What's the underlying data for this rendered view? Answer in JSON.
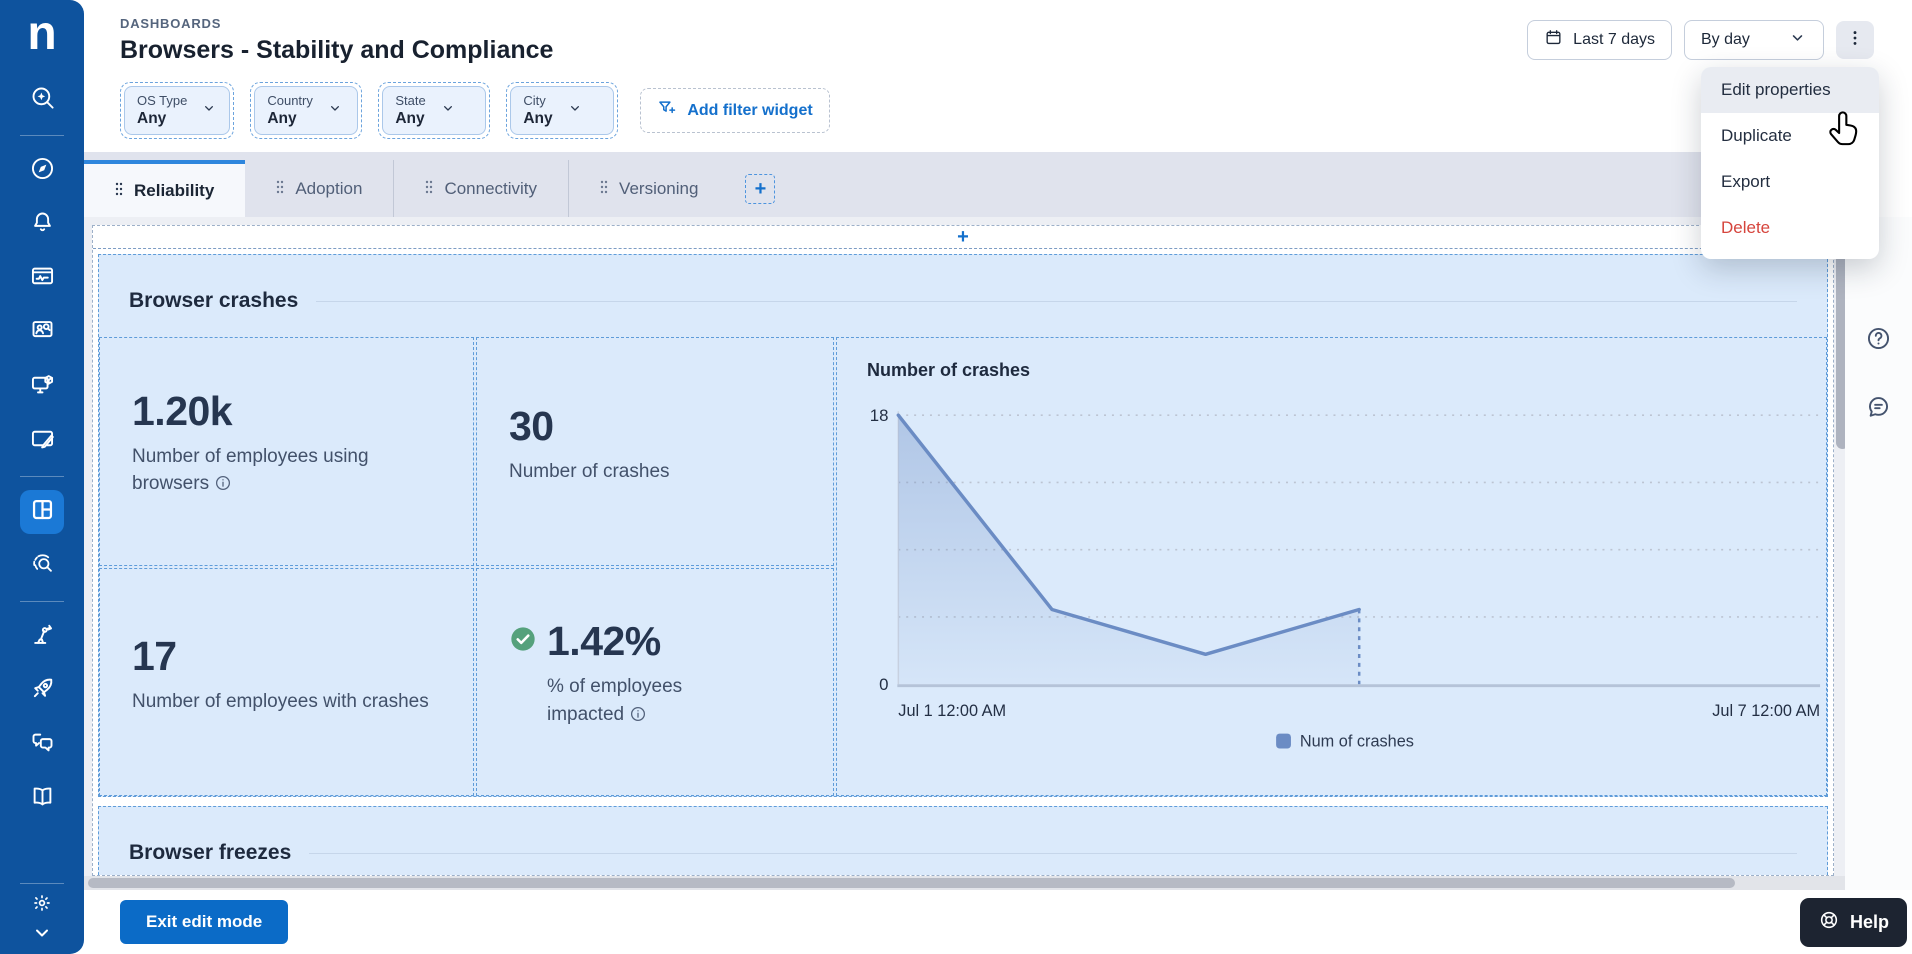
{
  "brand": {
    "logo_letter": "n"
  },
  "header": {
    "breadcrumb": "DASHBOARDS",
    "title": "Browsers - Stability and Compliance",
    "time_range_label": "Last 7 days",
    "granularity_label": "By day"
  },
  "menu": {
    "items": [
      {
        "label": "Edit properties",
        "state": "hovered"
      },
      {
        "label": "Duplicate"
      },
      {
        "label": "Export"
      },
      {
        "label": "Delete",
        "danger": true
      }
    ]
  },
  "filters": {
    "widgets": [
      {
        "label": "OS Type",
        "value": "Any"
      },
      {
        "label": "Country",
        "value": "Any"
      },
      {
        "label": "State",
        "value": "Any"
      },
      {
        "label": "City",
        "value": "Any"
      }
    ],
    "add_label": "Add filter widget"
  },
  "tabs": {
    "items": [
      {
        "label": "Reliability",
        "active": true
      },
      {
        "label": "Adoption",
        "active": false
      },
      {
        "label": "Connectivity",
        "active": false
      },
      {
        "label": "Versioning",
        "active": false
      }
    ],
    "add_symbol": "+"
  },
  "canvas": {
    "add_row_symbol": "+"
  },
  "sections": {
    "crashes_title": "Browser crashes",
    "freezes_title": "Browser freezes"
  },
  "kpis": [
    {
      "value": "1.20k",
      "label": "Number of employees using browsers",
      "info_icon": true
    },
    {
      "value": "30",
      "label": "Number of crashes",
      "info_icon": false
    },
    {
      "value": "17",
      "label": "Number of employees with crashes",
      "info_icon": false
    },
    {
      "value": "1.42%",
      "label": "% of employees impacted",
      "info_icon": true,
      "status": "good",
      "status_color": "#55a17c"
    }
  ],
  "chart_data": {
    "type": "line",
    "title": "Number of crashes",
    "series": [
      {
        "name": "Num of crashes",
        "color": "#6b8cc4",
        "points": [
          {
            "label": "Jul 1",
            "day": 0,
            "y": 18
          },
          {
            "label": "Jul 2",
            "day": 1,
            "y": 5
          },
          {
            "label": "Jul 3",
            "day": 2,
            "y": 2
          },
          {
            "label": "Jul 4",
            "day": 3,
            "y": 5
          }
        ],
        "last_point_provisional": true
      }
    ],
    "x_axis": {
      "start_label": "Jul 1 12:00 AM",
      "end_label": "Jul 7 12:00 AM",
      "span_days": 6
    },
    "y_axis": {
      "min": 0,
      "max": 18,
      "labeled_ticks": [
        18,
        0
      ],
      "gridline_values": [
        18,
        13.5,
        9,
        4.5
      ]
    },
    "legend": {
      "position": "bottom-center",
      "entries": [
        "Num of crashes"
      ]
    },
    "grid": "dotted-horizontal"
  },
  "footer": {
    "exit_label": "Exit edit mode",
    "help_label": "Help"
  },
  "colors": {
    "sidebar_blue": "#0e539e",
    "active_tile_blue": "#1b79d6",
    "accent_blue": "#1470cc",
    "section_bg": "#dbeafb",
    "dashed_border": "#5f9cd9",
    "line_color": "#6b8cc4",
    "delete_red": "#d6453d",
    "success_green": "#55a17c"
  }
}
